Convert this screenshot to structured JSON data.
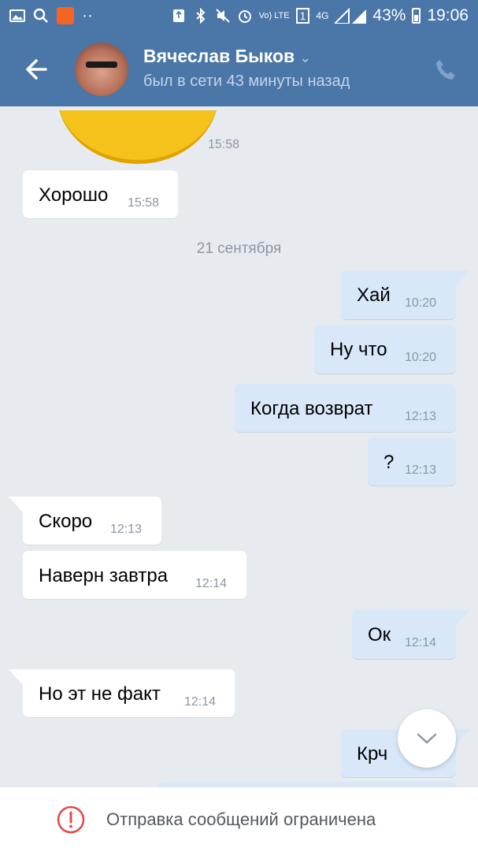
{
  "status_bar": {
    "battery": "43%",
    "time": "19:06",
    "network": "4G",
    "sim": "1",
    "volte": "Vo) LTE",
    "icons": [
      "gallery-icon",
      "search-icon",
      "app-notification-icon",
      "more-icon",
      "recycle-icon",
      "bluetooth-icon",
      "mute-icon",
      "alarm-icon",
      "volte-icon",
      "sim-icon",
      "signal-icon",
      "battery-icon"
    ]
  },
  "header": {
    "name": "Вячеслав Быков",
    "status": "был в сети 43 минуты назад",
    "back_icon": "back-arrow-icon",
    "call_icon": "phone-icon"
  },
  "chat": {
    "sticker_time": "15:58",
    "date_separator": "21 сентября",
    "messages": [
      {
        "dir": "in",
        "text": "Хорошо",
        "time": "15:58"
      },
      {
        "dir": "out",
        "text": "Хай",
        "time": "10:20"
      },
      {
        "dir": "out",
        "text": "Ну что",
        "time": "10:20"
      },
      {
        "dir": "out",
        "text": "Когда возврат",
        "time": "12:13"
      },
      {
        "dir": "out",
        "text": "?",
        "time": "12:13"
      },
      {
        "dir": "in",
        "text": "Скоро",
        "time": "12:13"
      },
      {
        "dir": "in",
        "text": "Наверн завтра",
        "time": "12:14"
      },
      {
        "dir": "out",
        "text": "Ок",
        "time": "12:14"
      },
      {
        "dir": "in",
        "text": "Но эт не факт",
        "time": "12:14"
      },
      {
        "dir": "out",
        "text": "Крч",
        "time": ""
      }
    ]
  },
  "footer": {
    "message": "Отправка сообщений ограничена",
    "icon": "alert-circle-icon"
  },
  "colors": {
    "header_bg": "#4a76a8",
    "chat_bg": "#e7ebf0",
    "incoming_bubble": "#ffffff",
    "outgoing_bubble": "#d9e8f8",
    "alert_red": "#e64646"
  }
}
